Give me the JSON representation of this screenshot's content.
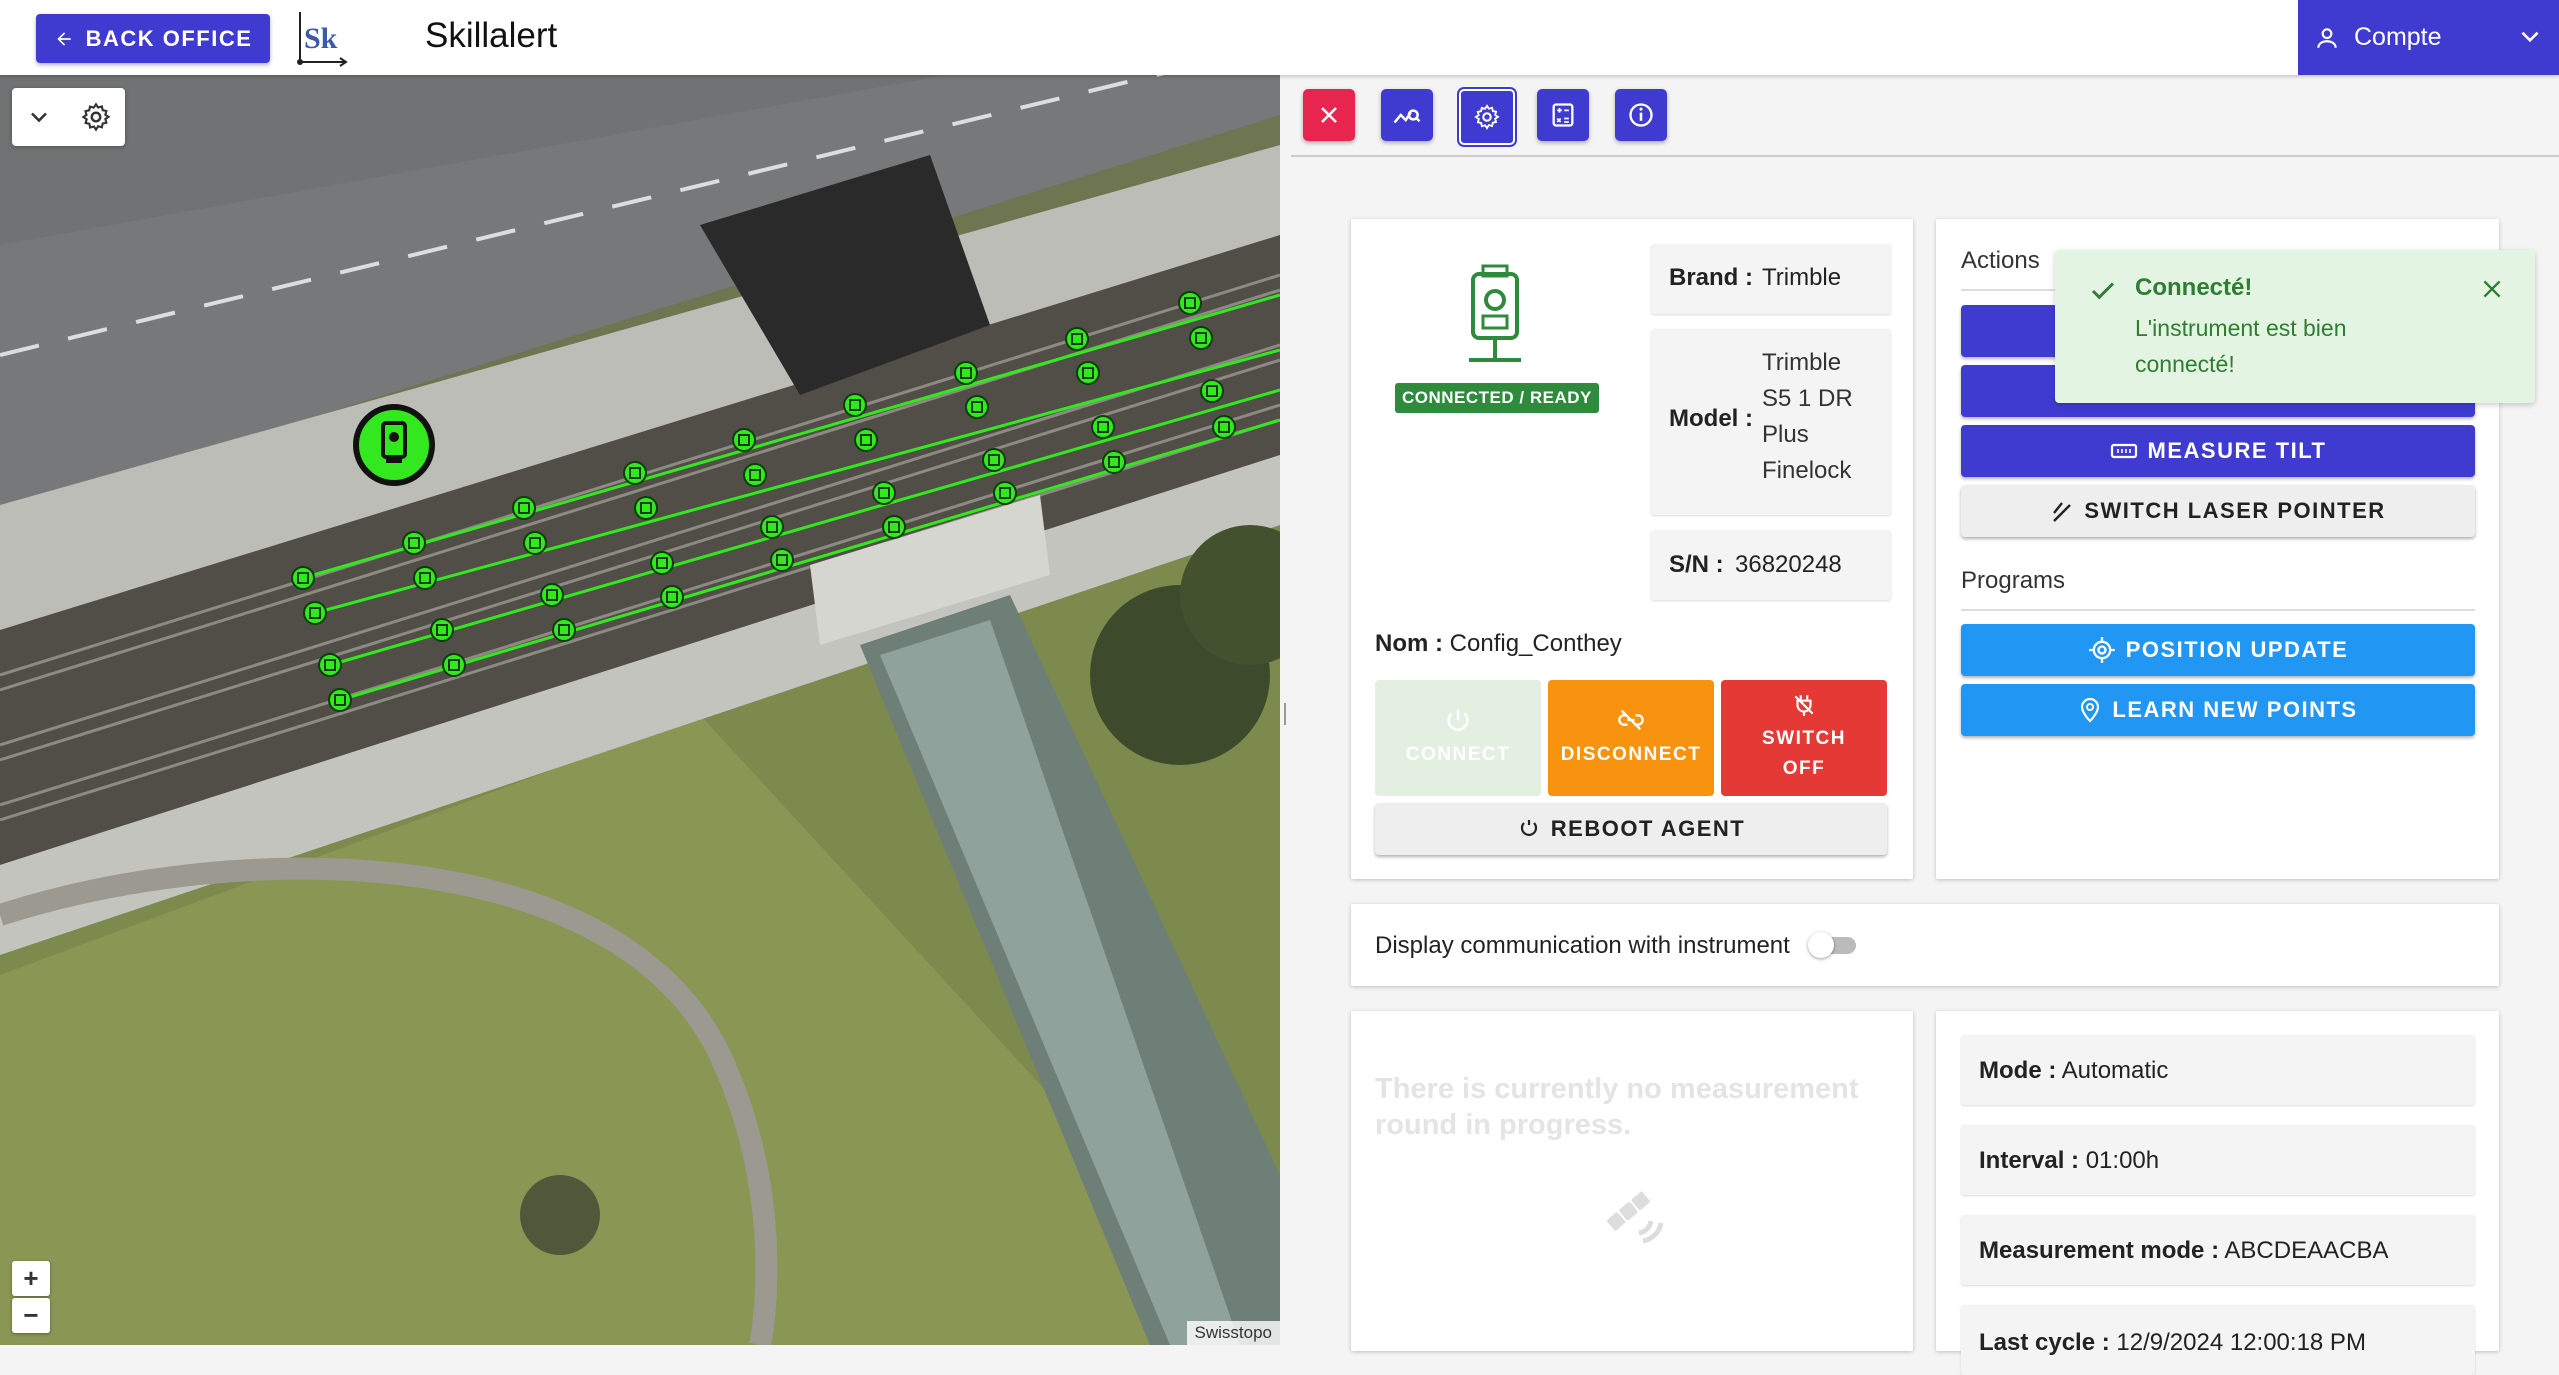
{
  "header": {
    "back_label": "BACK OFFICE",
    "logo_text": "Sk",
    "title": "Skillalert",
    "account_label": "Compte"
  },
  "map": {
    "attribution": "Swisstopo",
    "zoom_in": "+",
    "zoom_out": "−"
  },
  "toolbar": {
    "buttons": [
      "close-icon",
      "chart-search-icon",
      "gear-icon",
      "calculator-icon",
      "info-icon"
    ]
  },
  "instrument": {
    "status_badge": "CONNECTED / READY",
    "brand_label": "Brand :",
    "brand_value": "Trimble",
    "model_label": "Model :",
    "model_value": "Trimble S5 1 DR Plus Finelock",
    "sn_label": "S/N :",
    "sn_value": "36820248",
    "name_label": "Nom :",
    "name_value": "Config_Conthey",
    "connect_label": "CONNECT",
    "disconnect_label": "DISCONNECT",
    "switch_off_label": "SWITCH OFF",
    "reboot_label": "REBOOT AGENT"
  },
  "actions": {
    "title": "Actions",
    "measure_tilt_label": "MEASURE TILT",
    "laser_pointer_label": "SWITCH LASER POINTER",
    "programs_title": "Programs",
    "position_update_label": "POSITION UPDATE",
    "learn_points_label": "LEARN NEW POINTS"
  },
  "toast": {
    "title": "Connecté!",
    "message": "L'instrument est bien connecté!"
  },
  "communication": {
    "label": "Display communication with instrument",
    "enabled": false
  },
  "round": {
    "empty_text": "There is currently no measurement round in progress."
  },
  "settings": {
    "mode_label": "Mode :",
    "mode_value": "Automatic",
    "interval_label": "Interval :",
    "interval_value": "01:00h",
    "measurement_mode_label": "Measurement mode :",
    "measurement_mode_value": "ABCDEAACBA",
    "last_cycle_label": "Last cycle :",
    "last_cycle_value": "12/9/2024 12:00:18 PM"
  },
  "colors": {
    "primary": "#3f3bd1",
    "danger": "#e53935",
    "warning": "#f7930f",
    "info": "#2196f3",
    "success": "#2e8b3c",
    "point_green": "#33e81f"
  }
}
